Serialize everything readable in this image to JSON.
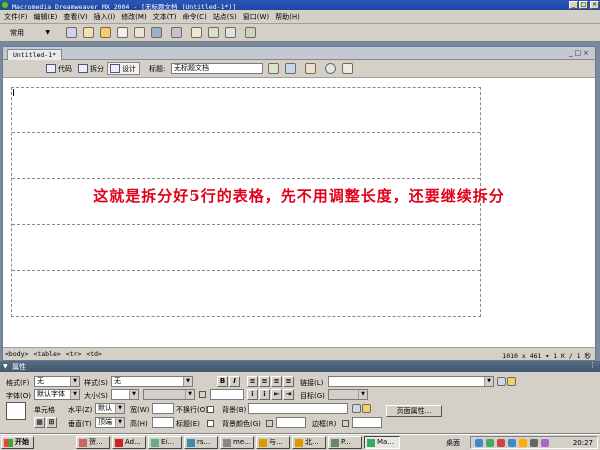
{
  "window": {
    "title": "Macromedia Dreamweaver MX 2004 - [无标题文档 (Untitled-1*)]",
    "min": "_",
    "max": "□",
    "close": "×"
  },
  "menu": [
    "文件(F)",
    "编辑(E)",
    "查看(V)",
    "插入(I)",
    "修改(M)",
    "文本(T)",
    "命令(C)",
    "站点(S)",
    "窗口(W)",
    "帮助(H)"
  ],
  "insertbar": {
    "category": "常用",
    "icons": [
      "hyperlink-icon",
      "email-link-icon",
      "named-anchor-icon",
      "table-icon",
      "layer-icon",
      "images-icon",
      "media-icon",
      "date-icon",
      "comment-icon",
      "templates-icon",
      "tag-chooser-icon"
    ]
  },
  "document": {
    "tab": "Untitled-1*",
    "views": {
      "code": "代码",
      "split": "拆分",
      "design": "设计"
    },
    "title_label": "标题:",
    "title_value": "无标题文档",
    "annotation": "这就是拆分好5行的表格，先不用调整长度，还要继续拆分",
    "table_rows": 5,
    "tag_path": [
      "<body>",
      "<table>",
      "<tr>",
      "<td>"
    ],
    "size_info": "1010 x 461",
    "file_info": "1 K / 1 秒"
  },
  "properties": {
    "header": "属性",
    "format_label": "格式(F)",
    "format_value": "无",
    "style_label": "样式(S)",
    "style_value": "无",
    "link_label": "链接(L)",
    "font_label": "字体(O)",
    "font_value": "默认字体",
    "size_label": "大小(S)",
    "size_value": "",
    "target_label": "目标(G)",
    "cell_label": "单元格",
    "horz_label": "水平(Z)",
    "horz_value": "默认",
    "vert_label": "垂直(T)",
    "vert_value": "顶端",
    "width_label": "宽(W)",
    "height_label": "高(H)",
    "nowrap_label": "不换行(O)",
    "header_label": "标题(E)",
    "bg_label": "背景(B)",
    "bgcolor_label": "背景颜色(G)",
    "border_label": "边框(R)",
    "page_props_button": "页面属性..."
  },
  "taskbar": {
    "start": "开始",
    "items": [
      "贺...",
      "Ad...",
      "Ei...",
      "rs...",
      "me...",
      "与...",
      "北...",
      "P...",
      "Ma..."
    ],
    "desktop_label": "桌面",
    "clock": "20:27"
  }
}
